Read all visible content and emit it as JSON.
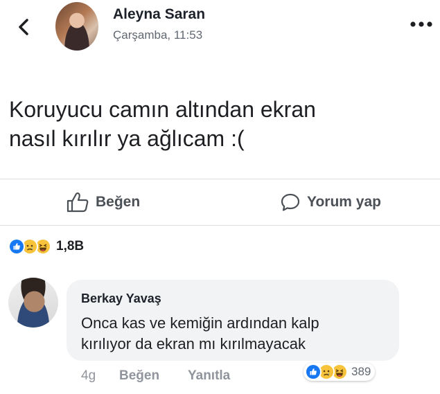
{
  "header": {
    "back_icon": "chevron-left-icon",
    "author_name": "Aleyna Saran",
    "timestamp": "Çarşamba, 11:53",
    "more_icon": "more-horizontal-icon"
  },
  "post": {
    "text_line1": "Koruyucu camın altından ekran",
    "text_line2": "nasıl kırılır ya ağlıcam :("
  },
  "actions": {
    "like_label": "Beğen",
    "comment_label": "Yorum yap"
  },
  "reactions": {
    "icons": [
      "like-icon",
      "sad-icon",
      "haha-icon"
    ],
    "count": "1,8B"
  },
  "comment": {
    "author_name": "Berkay Yavaş",
    "text_line1": "Onca kas ve kemiğin ardından kalp",
    "text_line2": "kırılıyor da ekran mı kırılmayacak",
    "age": "4g",
    "like_label": "Beğen",
    "reply_label": "Yanıtla",
    "reaction_icons": [
      "like-icon",
      "sad-icon",
      "haha-icon"
    ],
    "reaction_count": "389"
  },
  "colors": {
    "like_blue": "#1877f2",
    "emoji_yellow": "#f7c33b",
    "secondary_text": "#90949c"
  }
}
